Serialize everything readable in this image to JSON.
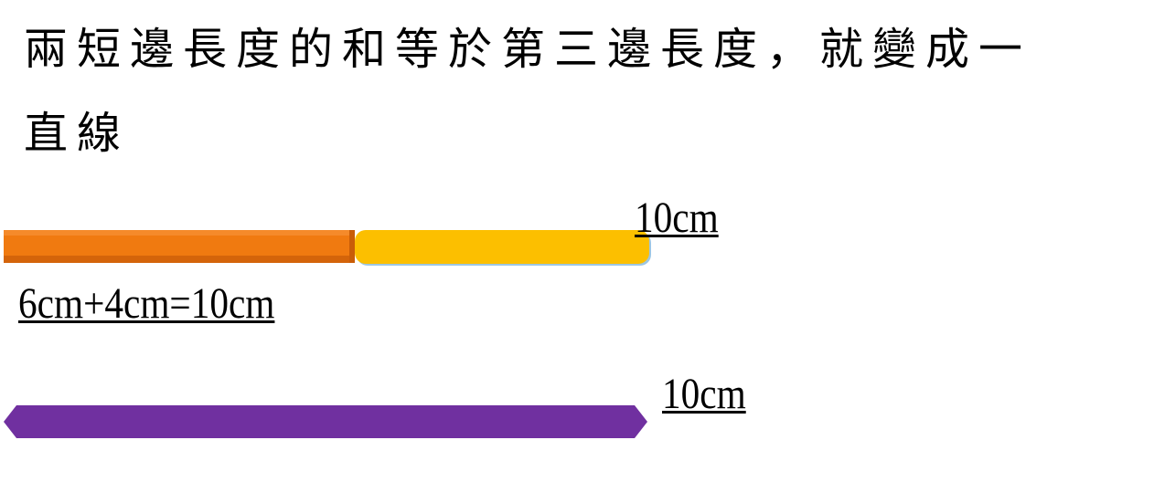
{
  "heading": {
    "line1": "兩短邊長度的和等於第三邊長度，就變成一",
    "line2": "直線"
  },
  "top_row": {
    "total_label": "10cm"
  },
  "equation": {
    "text": "6cm+4cm=10cm"
  },
  "bottom_row": {
    "total_label": "10cm"
  },
  "colors": {
    "segment_6cm": "#f07a10",
    "segment_4cm": "#fcbf00",
    "segment_10cm": "#7030a0",
    "text": "#000000",
    "background": "#ffffff"
  }
}
